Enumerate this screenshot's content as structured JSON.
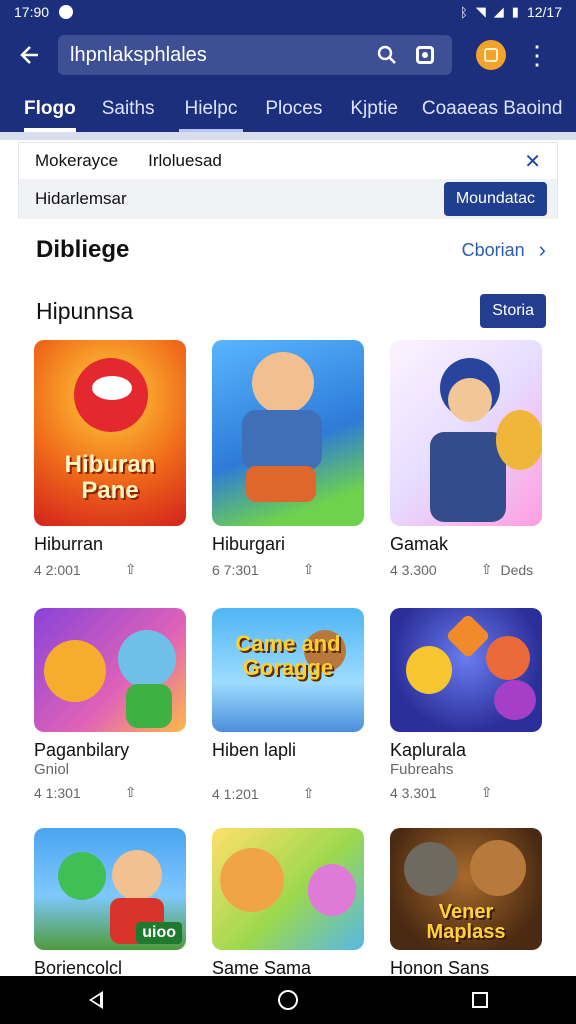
{
  "status_bar": {
    "time": "17:90",
    "right_time": "12/17",
    "icons": [
      "bluetooth-icon",
      "wifi-icon",
      "signal-icon",
      "battery-icon"
    ]
  },
  "app_bar": {
    "search_value": "lhpnlaksphlales",
    "icons": [
      "back-arrow-icon",
      "search-icon",
      "lens-icon",
      "account-avatar",
      "more-vert-icon"
    ]
  },
  "tabs": [
    {
      "label": "Flogo",
      "active": true
    },
    {
      "label": "Saiths"
    },
    {
      "label": "Hielpc"
    },
    {
      "label": "Ploces"
    },
    {
      "label": "Kjptie"
    },
    {
      "label": "Coaaeas Baoind"
    }
  ],
  "filters": {
    "chips": [
      "Mokerayce",
      "Irloluesad"
    ],
    "subtitle": "Hidarlemsar",
    "apply_label": "Moundatac"
  },
  "section": {
    "title": "Dibliege",
    "see_all": "Cborian",
    "subtitle": "Hipunnsa",
    "sort_label": "Storia"
  },
  "apps": [
    {
      "title": "Hiburran",
      "rating": "4 2:001",
      "thumb_text": "Hiburan Pane"
    },
    {
      "title": "Hiburgari",
      "rating": "6 7:301"
    },
    {
      "title": "Gamak",
      "rating": "4 3.300",
      "extra": "Deds"
    },
    {
      "title": "Paganbilary",
      "subtitle": "Gniol",
      "rating": "4 1:301"
    },
    {
      "title": "Hiben lapli",
      "rating": "4 1:201",
      "thumb_text": "Came and Goragge"
    },
    {
      "title": "Kaplurala",
      "subtitle": "Fubreahs",
      "rating": "4 3.301"
    },
    {
      "title": "Boriencolcl",
      "badge": "uioo"
    },
    {
      "title": "Same Sama"
    },
    {
      "title": "Honon Sans",
      "thumb_text": "Vener Maplass"
    }
  ]
}
